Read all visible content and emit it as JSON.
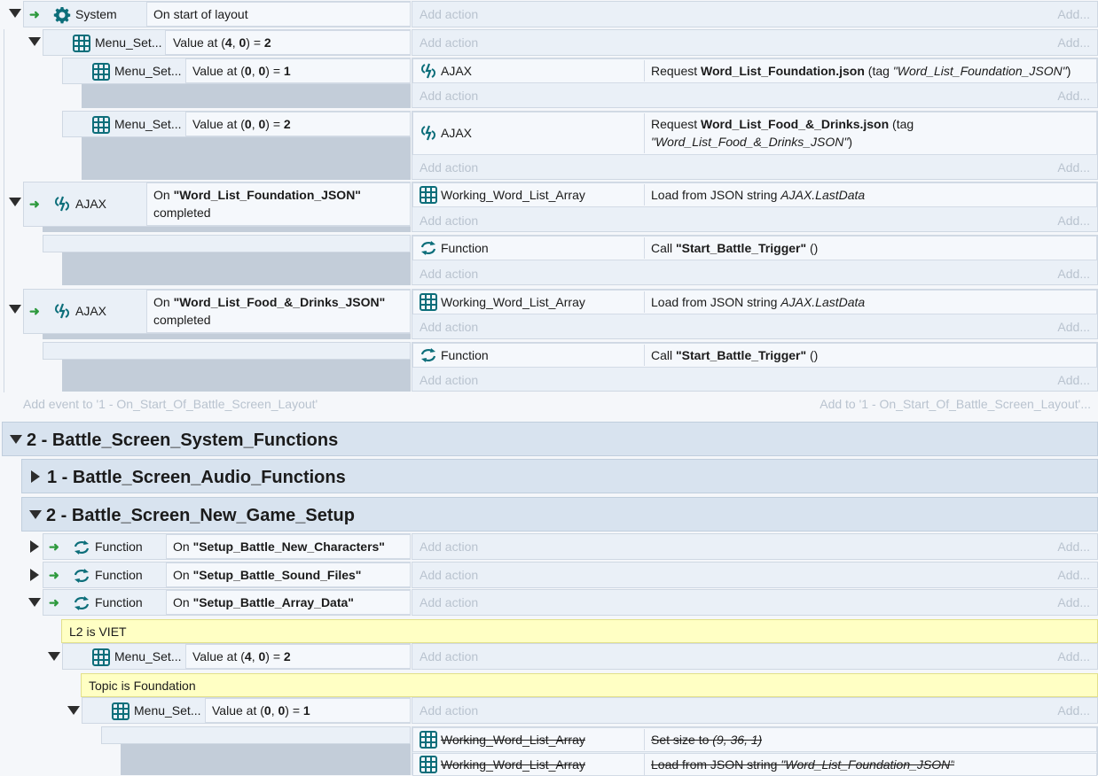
{
  "events": {
    "e1": {
      "object": "System",
      "condition": "On start of layout",
      "add_action": "Add action",
      "add": "Add..."
    },
    "e2": {
      "object": "Menu_Set...",
      "cond_pre": "Value at (",
      "x": "4",
      "mid": ", ",
      "y": "0",
      "post": ") = ",
      "val": "2",
      "add_action": "Add action",
      "add": "Add..."
    },
    "e3": {
      "object": "Menu_Set...",
      "cond_pre": "Value at (",
      "x": "0",
      "mid": ", ",
      "y": "0",
      "post": ") = ",
      "val": "1",
      "action_obj": "AJAX",
      "action_pre": "Request ",
      "action_bold": "Word_List_Foundation.json",
      "action_mid": " (tag ",
      "action_ital": "\"Word_List_Foundation_JSON\"",
      "action_post": ")",
      "add_action": "Add action",
      "add": "Add..."
    },
    "e4": {
      "object": "Menu_Set...",
      "cond_pre": "Value at (",
      "x": "0",
      "mid": ", ",
      "y": "0",
      "post": ") = ",
      "val": "2",
      "action_obj": "AJAX",
      "action_pre": "Request ",
      "action_bold": "Word_List_Food_&_Drinks.json",
      "action_mid": " (tag",
      "action_ital": "\"Word_List_Food_&_Drinks_JSON\"",
      "action_post": ")",
      "add_action": "Add action",
      "add": "Add..."
    },
    "e5": {
      "object": "AJAX",
      "cond_pre": "On ",
      "cond_bold": "\"Word_List_Foundation_JSON\"",
      "cond_post": "completed",
      "action_obj": "Working_Word_List_Array",
      "action_pre": "Load from JSON string ",
      "action_ital": "AJAX.LastData",
      "add_action": "Add action",
      "add": "Add..."
    },
    "e6": {
      "action_obj": "Function",
      "action_pre": "Call ",
      "action_bold": "\"Start_Battle_Trigger\"",
      "action_post": " ()",
      "add_action": "Add action",
      "add": "Add..."
    },
    "e7": {
      "object": "AJAX",
      "cond_pre": "On ",
      "cond_bold": "\"Word_List_Food_&_Drinks_JSON\"",
      "cond_post": "completed",
      "action_obj": "Working_Word_List_Array",
      "action_pre": "Load from JSON string ",
      "action_ital": "AJAX.LastData",
      "add_action": "Add action",
      "add": "Add..."
    },
    "e8": {
      "action_obj": "Function",
      "action_pre": "Call ",
      "action_bold": "\"Start_Battle_Trigger\"",
      "action_post": " ()",
      "add_action": "Add action",
      "add": "Add..."
    }
  },
  "add_event": "Add event to '1 - On_Start_Of_Battle_Screen_Layout'",
  "add_to": "Add to '1 - On_Start_Of_Battle_Screen_Layout'...",
  "groups": {
    "g2": "2 - Battle_Screen_System_Functions",
    "g21": "1 - Battle_Screen_Audio_Functions",
    "g22": "2 - Battle_Screen_New_Game_Setup"
  },
  "funcs": [
    {
      "object": "Function",
      "pre": "On ",
      "bold": "\"Setup_Battle_New_Characters\"",
      "add_action": "Add action",
      "add": "Add..."
    },
    {
      "object": "Function",
      "pre": "On ",
      "bold": "\"Setup_Battle_Sound_Files\"",
      "add_action": "Add action",
      "add": "Add..."
    },
    {
      "object": "Function",
      "pre": "On ",
      "bold": "\"Setup_Battle_Array_Data\"",
      "add_action": "Add action",
      "add": "Add..."
    }
  ],
  "comments": {
    "c1": "L2 is VIET",
    "c2": "Topic is Foundation"
  },
  "sub1": {
    "object": "Menu_Set...",
    "cond_pre": "Value at (",
    "x": "4",
    "mid": ", ",
    "y": "0",
    "post": ") = ",
    "val": "2",
    "add_action": "Add action",
    "add": "Add..."
  },
  "sub2": {
    "object": "Menu_Set...",
    "cond_pre": "Value at (",
    "x": "0",
    "mid": ", ",
    "y": "0",
    "post": ") = ",
    "val": "1",
    "add_action": "Add action",
    "add": "Add..."
  },
  "disabled": [
    {
      "object": "Working_Word_List_Array",
      "action": "Set size to ",
      "ital": "(9, 36, 1)"
    },
    {
      "object": "Working_Word_List_Array",
      "action": "Load from JSON string ",
      "ital": "\"Word_List_Foundation_JSON\""
    }
  ],
  "colors": {
    "accent": "#0c6e7a",
    "arrow": "#2e9a3e",
    "comment": "#ffffc4"
  }
}
